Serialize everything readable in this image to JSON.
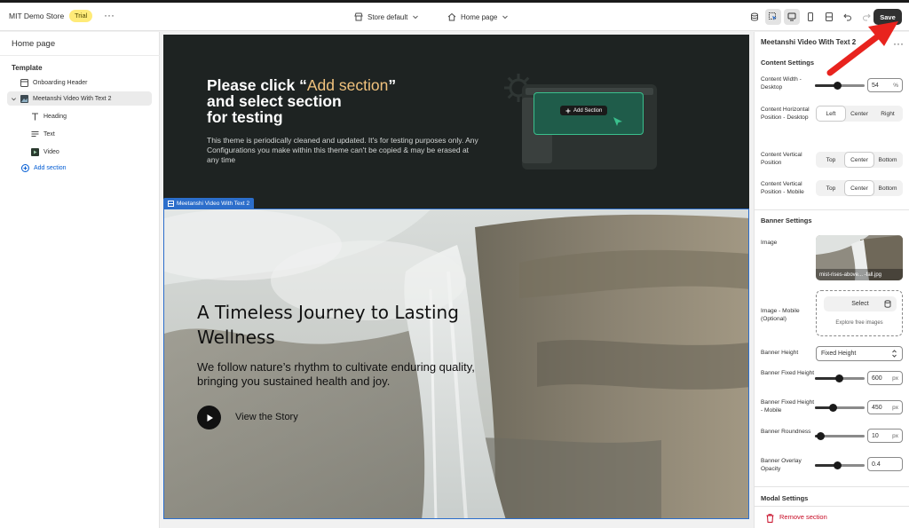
{
  "topbar": {
    "store_name": "MIT Demo Store",
    "trial_badge": "Trial",
    "theme_selector": "Store default",
    "page_selector": "Home page",
    "save_label": "Save"
  },
  "sidebar": {
    "title": "Home page",
    "template_label": "Template",
    "items": [
      {
        "label": "Onboarding Header",
        "icon": "layout-icon"
      },
      {
        "label": "Meetanshi Video With Text 2",
        "icon": "image-icon"
      },
      {
        "label": "Heading",
        "icon": "heading-icon"
      },
      {
        "label": "Text",
        "icon": "text-icon"
      },
      {
        "label": "Video",
        "icon": "video-icon"
      }
    ],
    "add_section": "Add section"
  },
  "preview": {
    "top": {
      "heading_part1": "Please click “",
      "heading_highlight": "Add section",
      "heading_part2": "”",
      "heading_line2": "and select section",
      "heading_line3": "for testing",
      "paragraph": "This theme is periodically cleaned and updated. It's for testing purposes only. Any Configurations you make within this theme can't be copied & may be erased at any time",
      "mock_button": "Add Section"
    },
    "section_tag": "Meetanshi Video With Text 2",
    "banner": {
      "heading": "A Timeless Journey to Lasting Wellness",
      "text": "We follow nature’s rhythm to cultivate enduring quality, bringing you sustained health and joy.",
      "link": "View the Story"
    }
  },
  "panel": {
    "title": "Meetanshi Video With Text 2",
    "content_settings": "Content Settings",
    "content_width_label": "Content Width - Desktop",
    "content_width": {
      "value": "54",
      "unit": "%",
      "fraction": 0.45
    },
    "h_position_label": "Content Horizontal Position - Desktop",
    "h_options": [
      "Left",
      "Center",
      "Right"
    ],
    "h_selected": 0,
    "v_position_label": "Content Vertical Position",
    "v_options": [
      "Top",
      "Center",
      "Bottom"
    ],
    "v_selected": 1,
    "v_mobile_label": "Content Vertical Position - Mobile",
    "vm_options": [
      "Top",
      "Center",
      "Bottom"
    ],
    "vm_selected": 1,
    "banner_settings": "Banner Settings",
    "image_label": "Image",
    "image_caption": "mist-rises-above... -fall.jpg",
    "image_mobile_label": "Image - Mobile (Optional)",
    "select_label": "Select",
    "explore_label": "Explore free images",
    "banner_height_label": "Banner Height",
    "banner_height_value": "Fixed Height",
    "fixed_height_label": "Banner Fixed Height",
    "fixed_height": {
      "value": "600",
      "unit": "px",
      "fraction": 0.48
    },
    "fixed_height_mobile_label": "Banner Fixed Height - Mobile",
    "fixed_height_mobile": {
      "value": "450",
      "unit": "px",
      "fraction": 0.36
    },
    "roundness_label": "Banner Roundness",
    "roundness": {
      "value": "10",
      "unit": "px",
      "fraction": 0.1
    },
    "overlay_label": "Banner Overlay Opacity",
    "overlay": {
      "value": "0.4",
      "unit": "",
      "fraction": 0.45
    },
    "modal_settings": "Modal Settings",
    "remove_section": "Remove section"
  },
  "colors": {
    "accent": "#2c6ecb",
    "annotation_arrow": "#e8231e",
    "danger": "#c70a24"
  }
}
